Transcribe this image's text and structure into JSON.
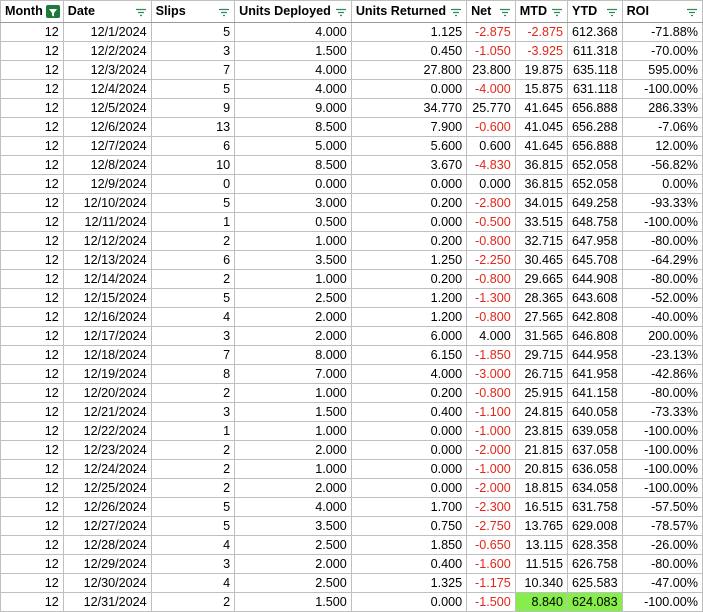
{
  "columns": [
    {
      "label": "Month",
      "filter_active": true
    },
    {
      "label": "Date",
      "filter_active": false
    },
    {
      "label": "Slips",
      "filter_active": false
    },
    {
      "label": "Units Deployed",
      "filter_active": false
    },
    {
      "label": "Units Returned",
      "filter_active": false
    },
    {
      "label": "Net",
      "filter_active": false
    },
    {
      "label": "MTD",
      "filter_active": false
    },
    {
      "label": "YTD",
      "filter_active": false
    },
    {
      "label": "ROI",
      "filter_active": false
    }
  ],
  "rows": [
    [
      "12",
      "12/1/2024",
      "5",
      "4.000",
      "1.125",
      "-2.875",
      "-2.875",
      "612.368",
      "-71.88%"
    ],
    [
      "12",
      "12/2/2024",
      "3",
      "1.500",
      "0.450",
      "-1.050",
      "-3.925",
      "611.318",
      "-70.00%"
    ],
    [
      "12",
      "12/3/2024",
      "7",
      "4.000",
      "27.800",
      "23.800",
      "19.875",
      "635.118",
      "595.00%"
    ],
    [
      "12",
      "12/4/2024",
      "5",
      "4.000",
      "0.000",
      "-4.000",
      "15.875",
      "631.118",
      "-100.00%"
    ],
    [
      "12",
      "12/5/2024",
      "9",
      "9.000",
      "34.770",
      "25.770",
      "41.645",
      "656.888",
      "286.33%"
    ],
    [
      "12",
      "12/6/2024",
      "13",
      "8.500",
      "7.900",
      "-0.600",
      "41.045",
      "656.288",
      "-7.06%"
    ],
    [
      "12",
      "12/7/2024",
      "6",
      "5.000",
      "5.600",
      "0.600",
      "41.645",
      "656.888",
      "12.00%"
    ],
    [
      "12",
      "12/8/2024",
      "10",
      "8.500",
      "3.670",
      "-4.830",
      "36.815",
      "652.058",
      "-56.82%"
    ],
    [
      "12",
      "12/9/2024",
      "0",
      "0.000",
      "0.000",
      "0.000",
      "36.815",
      "652.058",
      "0.00%"
    ],
    [
      "12",
      "12/10/2024",
      "5",
      "3.000",
      "0.200",
      "-2.800",
      "34.015",
      "649.258",
      "-93.33%"
    ],
    [
      "12",
      "12/11/2024",
      "1",
      "0.500",
      "0.000",
      "-0.500",
      "33.515",
      "648.758",
      "-100.00%"
    ],
    [
      "12",
      "12/12/2024",
      "2",
      "1.000",
      "0.200",
      "-0.800",
      "32.715",
      "647.958",
      "-80.00%"
    ],
    [
      "12",
      "12/13/2024",
      "6",
      "3.500",
      "1.250",
      "-2.250",
      "30.465",
      "645.708",
      "-64.29%"
    ],
    [
      "12",
      "12/14/2024",
      "2",
      "1.000",
      "0.200",
      "-0.800",
      "29.665",
      "644.908",
      "-80.00%"
    ],
    [
      "12",
      "12/15/2024",
      "5",
      "2.500",
      "1.200",
      "-1.300",
      "28.365",
      "643.608",
      "-52.00%"
    ],
    [
      "12",
      "12/16/2024",
      "4",
      "2.000",
      "1.200",
      "-0.800",
      "27.565",
      "642.808",
      "-40.00%"
    ],
    [
      "12",
      "12/17/2024",
      "3",
      "2.000",
      "6.000",
      "4.000",
      "31.565",
      "646.808",
      "200.00%"
    ],
    [
      "12",
      "12/18/2024",
      "7",
      "8.000",
      "6.150",
      "-1.850",
      "29.715",
      "644.958",
      "-23.13%"
    ],
    [
      "12",
      "12/19/2024",
      "8",
      "7.000",
      "4.000",
      "-3.000",
      "26.715",
      "641.958",
      "-42.86%"
    ],
    [
      "12",
      "12/20/2024",
      "2",
      "1.000",
      "0.200",
      "-0.800",
      "25.915",
      "641.158",
      "-80.00%"
    ],
    [
      "12",
      "12/21/2024",
      "3",
      "1.500",
      "0.400",
      "-1.100",
      "24.815",
      "640.058",
      "-73.33%"
    ],
    [
      "12",
      "12/22/2024",
      "1",
      "1.000",
      "0.000",
      "-1.000",
      "23.815",
      "639.058",
      "-100.00%"
    ],
    [
      "12",
      "12/23/2024",
      "2",
      "2.000",
      "0.000",
      "-2.000",
      "21.815",
      "637.058",
      "-100.00%"
    ],
    [
      "12",
      "12/24/2024",
      "2",
      "1.000",
      "0.000",
      "-1.000",
      "20.815",
      "636.058",
      "-100.00%"
    ],
    [
      "12",
      "12/25/2024",
      "2",
      "2.000",
      "0.000",
      "-2.000",
      "18.815",
      "634.058",
      "-100.00%"
    ],
    [
      "12",
      "12/26/2024",
      "5",
      "4.000",
      "1.700",
      "-2.300",
      "16.515",
      "631.758",
      "-57.50%"
    ],
    [
      "12",
      "12/27/2024",
      "5",
      "3.500",
      "0.750",
      "-2.750",
      "13.765",
      "629.008",
      "-78.57%"
    ],
    [
      "12",
      "12/28/2024",
      "4",
      "2.500",
      "1.850",
      "-0.650",
      "13.115",
      "628.358",
      "-26.00%"
    ],
    [
      "12",
      "12/29/2024",
      "3",
      "2.000",
      "0.400",
      "-1.600",
      "11.515",
      "626.758",
      "-80.00%"
    ],
    [
      "12",
      "12/30/2024",
      "4",
      "2.500",
      "1.325",
      "-1.175",
      "10.340",
      "625.583",
      "-47.00%"
    ],
    [
      "12",
      "12/31/2024",
      "2",
      "1.500",
      "0.000",
      "-1.500",
      "8.840",
      "624.083",
      "-100.00%"
    ]
  ],
  "highlighted_cells": [
    [
      30,
      6
    ],
    [
      30,
      7
    ]
  ],
  "colors": {
    "negative_text": "#e0271b",
    "highlight_fill": "#85ee4b",
    "active_filter_fill": "#1e7a3a",
    "grid_line": "#bfbfbf"
  },
  "icons": {
    "filter_inactive": "filter-funnel-icon",
    "filter_active": "filter-active-icon"
  }
}
